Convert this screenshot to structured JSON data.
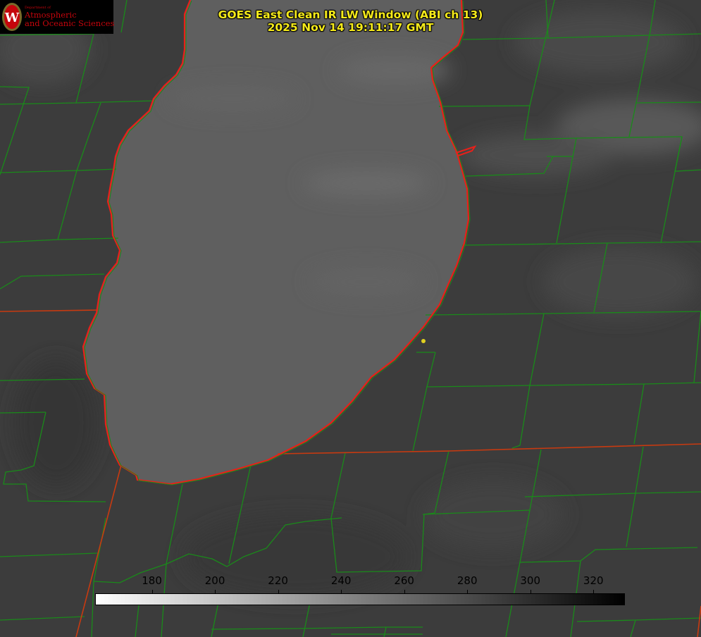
{
  "logo": {
    "dept": "Department of",
    "line1": "Atmospheric",
    "line2": "and Oceanic Sciences",
    "seal_letter": "W"
  },
  "title": {
    "line1": "GOES East Clean IR LW Window (ABI ch 13)",
    "line2": "2025 Nov 14 19:11:17 GMT"
  },
  "colorbar": {
    "min": 162,
    "max": 330,
    "ticks": [
      "180",
      "200",
      "220",
      "240",
      "260",
      "280",
      "300",
      "320"
    ],
    "from_color": "#ffffff",
    "to_color": "#000000"
  },
  "colors": {
    "county_lines": "#1a8a1a",
    "shoreline": "#e8201a",
    "state_border": "#c83a10",
    "title_text": "#f5ea1a",
    "marker": "#e0d020"
  }
}
